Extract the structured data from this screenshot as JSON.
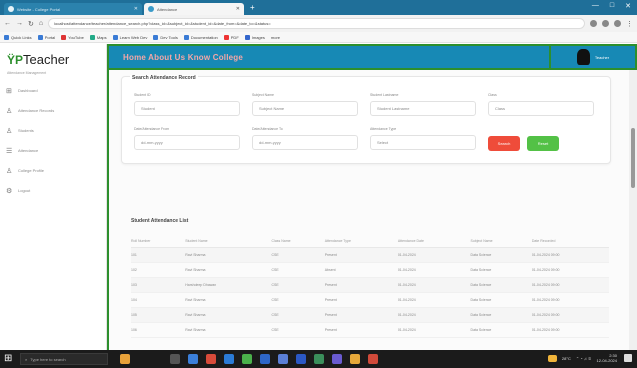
{
  "browser": {
    "tabs": [
      {
        "label": "Website - College Portal"
      },
      {
        "label": "Attendance"
      }
    ],
    "new_tab": "+",
    "window_controls": [
      "—",
      "□",
      "✕"
    ],
    "url": "localhost/attendance/teacher/attendance_search.php?class_id=&subject_id=&student_id=&date_from=&date_to=&status=",
    "bookmarks": [
      "Quick Links",
      "Portal",
      "YouTube",
      "Maps",
      "Learn Web Dev",
      "Dev Tools",
      "Documentation",
      "PDF",
      "Images",
      "more"
    ]
  },
  "sidebar": {
    "logo_text": "Teacher",
    "subtitle": "Attendance Management",
    "items": [
      {
        "icon": "dashboard-icon",
        "label": "Dashboard"
      },
      {
        "icon": "user-icon",
        "label": "Attendance Records"
      },
      {
        "icon": "people-icon",
        "label": "Students"
      },
      {
        "icon": "list-icon",
        "label": "Attendance"
      },
      {
        "icon": "document-icon",
        "label": "College Profile"
      },
      {
        "icon": "gear-icon",
        "label": "Logout"
      }
    ]
  },
  "header": {
    "brand": "Home About Us Know College",
    "user_name": "Teacher"
  },
  "search": {
    "title": "Search Attendance Record",
    "fields": [
      {
        "label": "Student ID",
        "value": "Student"
      },
      {
        "label": "Subject Name",
        "value": "Subject Name"
      },
      {
        "label": "Student Lastname",
        "value": "Student Lastname"
      },
      {
        "label": "Class",
        "value": "Class"
      },
      {
        "label": "Date/Attendance From",
        "value": "dd-mm-yyyy"
      },
      {
        "label": "Date/Attendance To",
        "value": "dd-mm-yyyy"
      },
      {
        "label": "Attendance Type",
        "value": "Select"
      }
    ],
    "search_label": "Search",
    "reset_label": "Reset"
  },
  "list": {
    "title": "Student Attendance List",
    "columns": [
      "Roll Number",
      "Student Name",
      "Class Name",
      "Attendance Type",
      "Attendance Date",
      "Subject Name",
      "Date Recorded"
    ],
    "rows": [
      [
        "101",
        "Ravi Sharma",
        "CSE",
        "Present",
        "01-04-2024",
        "Data Science",
        "01-04-2024 09:00"
      ],
      [
        "102",
        "Ravi Sharma",
        "CSE",
        "Absent",
        "01-04-2024",
        "Data Science",
        "01-04-2024 09:00"
      ],
      [
        "103",
        "Harshdeep Dhawan",
        "CSE",
        "Present",
        "01-04-2024",
        "Data Science",
        "01-04-2024 09:00"
      ],
      [
        "104",
        "Ravi Sharma",
        "CSE",
        "Present",
        "01-04-2024",
        "Data Science",
        "01-04-2024 09:00"
      ],
      [
        "105",
        "Ravi Sharma",
        "CSE",
        "Present",
        "01-04-2024",
        "Data Science",
        "01-04-2024 09:00"
      ],
      [
        "106",
        "Ravi Sharma",
        "CSE",
        "Present",
        "01-04-2024",
        "Data Science",
        "01-04-2024 09:00"
      ]
    ]
  },
  "taskbar": {
    "search_placeholder": "Type here to search",
    "temp": "28°C",
    "time": "2:30",
    "date": "12-04-2024"
  }
}
